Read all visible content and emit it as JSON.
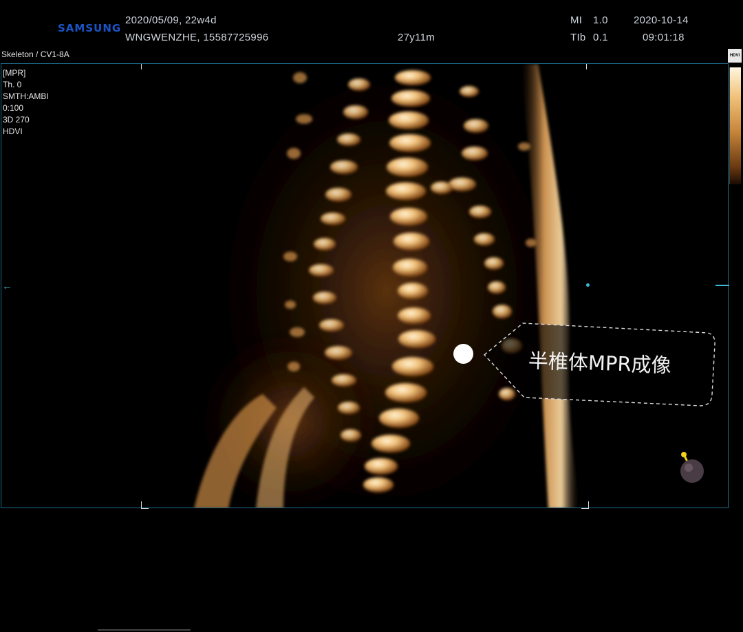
{
  "header": {
    "brand": "SAMSUNG",
    "exam_date_ga": "2020/05/09, 22w4d",
    "patient": "WNGWENZHE, 15587725996",
    "age": "27y11m",
    "mi_label": "MI",
    "mi_value": "1.0",
    "tib_label": "TIb",
    "tib_value": "0.1",
    "date": "2020-10-14",
    "time": "09:01:18"
  },
  "preset": "Skeleton / CV1-8A",
  "params": [
    "[MPR]",
    "Th. 0",
    "SMTH:AMBI",
    "0:100",
    "3D 270",
    "HDVI"
  ],
  "colorbar_badge": "HDVI",
  "callout": {
    "text": "半椎体MPR成像"
  },
  "colors": {
    "accent": "#3bb9d6",
    "brand": "#1a55c8",
    "bone": "#f1c27a"
  }
}
